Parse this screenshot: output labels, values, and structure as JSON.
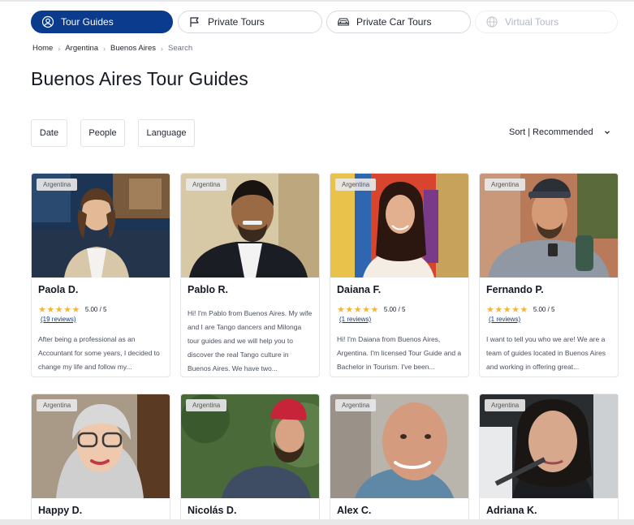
{
  "tabs": [
    {
      "label": "Tour Guides",
      "icon": "user-circle-icon",
      "active": true
    },
    {
      "label": "Private Tours",
      "icon": "flag-icon",
      "active": false
    },
    {
      "label": "Private Car Tours",
      "icon": "car-icon",
      "active": false
    },
    {
      "label": "Virtual Tours",
      "icon": "globe-icon",
      "active": false,
      "disabled": true
    }
  ],
  "breadcrumb": {
    "items": [
      "Home",
      "Argentina",
      "Buenos Aires"
    ],
    "current": "Search",
    "separator": "›"
  },
  "page_title": "Buenos Aires Tour Guides",
  "filters": {
    "date": "Date",
    "people": "People",
    "language": "Language"
  },
  "sort": {
    "label": "Sort",
    "value": "Recommended"
  },
  "colors": {
    "accent": "#0b3b8c",
    "star": "#f4b53f"
  },
  "guides": [
    {
      "country": "Argentina",
      "name": "Paola D.",
      "stars": "★★★★★",
      "rating": "5.00 / 5",
      "reviews": "(19 reviews)",
      "description": "After being a professional as an Accountant for some years, I decided to change my life and follow my..."
    },
    {
      "country": "Argentina",
      "name": "Pablo R.",
      "description": "Hi! I'm Pablo from Buenos Aires. My wife and I are Tango dancers and Milonga tour guides and we will help you to discover the real Tango culture in Buenos Aires. We have two..."
    },
    {
      "country": "Argentina",
      "name": "Daiana F.",
      "stars": "★★★★★",
      "rating": "5.00 / 5",
      "reviews": "(1 reviews)",
      "description": "Hi! I'm Daiana from Buenos Aires, Argentina. I'm licensed Tour Guide and a Bachelor in Tourism. I've been..."
    },
    {
      "country": "Argentina",
      "name": "Fernando P.",
      "stars": "★★★★★",
      "rating": "5.00 / 5",
      "reviews": "(1 reviews)",
      "description": "I want to tell you who we are! We are a team of guides located in Buenos Aires and working in offering great..."
    },
    {
      "country": "Argentina",
      "name": "Happy D."
    },
    {
      "country": "Argentina",
      "name": "Nicolás D."
    },
    {
      "country": "Argentina",
      "name": "Alex C."
    },
    {
      "country": "Argentina",
      "name": "Adriana K."
    }
  ]
}
